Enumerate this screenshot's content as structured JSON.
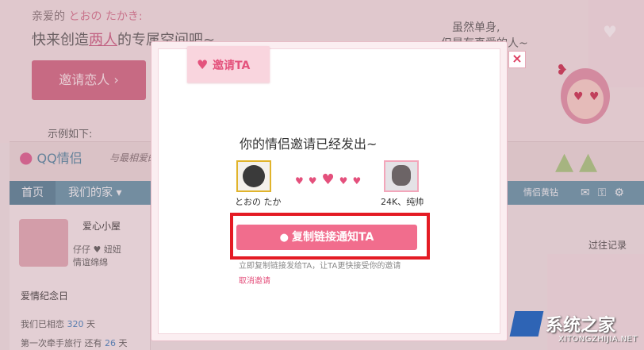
{
  "header": {
    "greet_prefix": "亲爱的",
    "user_name": "とおの たかき:",
    "slogan_prefix": "快来创造",
    "slogan_highlight": "两人",
    "slogan_suffix": "的专属空间吧~",
    "invite_button": "邀请恋人 ›",
    "example": "示例如下:",
    "right_text_1": "虽然单身,",
    "right_text_2": "但是有真爱的人~"
  },
  "site": {
    "logo": "QQ情侣",
    "tagline": "与最相爱的",
    "nav_home": "首页",
    "nav_mine": "我们的家 ▾",
    "nav_vip": "情侣黄钻"
  },
  "profile": {
    "name": "爱心小屋",
    "line1": "仔仔 ♥ 妞妞",
    "line2": "情谊绵绵",
    "anniversary_title": "爱情纪念日",
    "anni_1_prefix": "我们已相恋",
    "anni_1_num": "320",
    "anni_1_unit": "天",
    "anni_2_prefix": "第一次牵手旅行 还有",
    "anni_2_num": "26",
    "anni_2_unit": "天",
    "history": "过往记录"
  },
  "modal": {
    "tab_label": "邀请TA",
    "sent_message": "你的情侣邀请已经发出~",
    "left_name": "とおの たか",
    "right_name": "24K、纯帅",
    "copy_button": "复制链接通知TA",
    "hint": "立即复制链接发给TA，让TA更快接受你的邀请",
    "cancel": "取消邀请",
    "close": "×"
  },
  "watermark": {
    "brand": "系统之家",
    "url": "XITONGZHIJIA.NET"
  },
  "colors": {
    "accent_pink": "#f16d8d",
    "highlight_red": "#e41b24",
    "nav_blue": "#5e8ea2"
  }
}
